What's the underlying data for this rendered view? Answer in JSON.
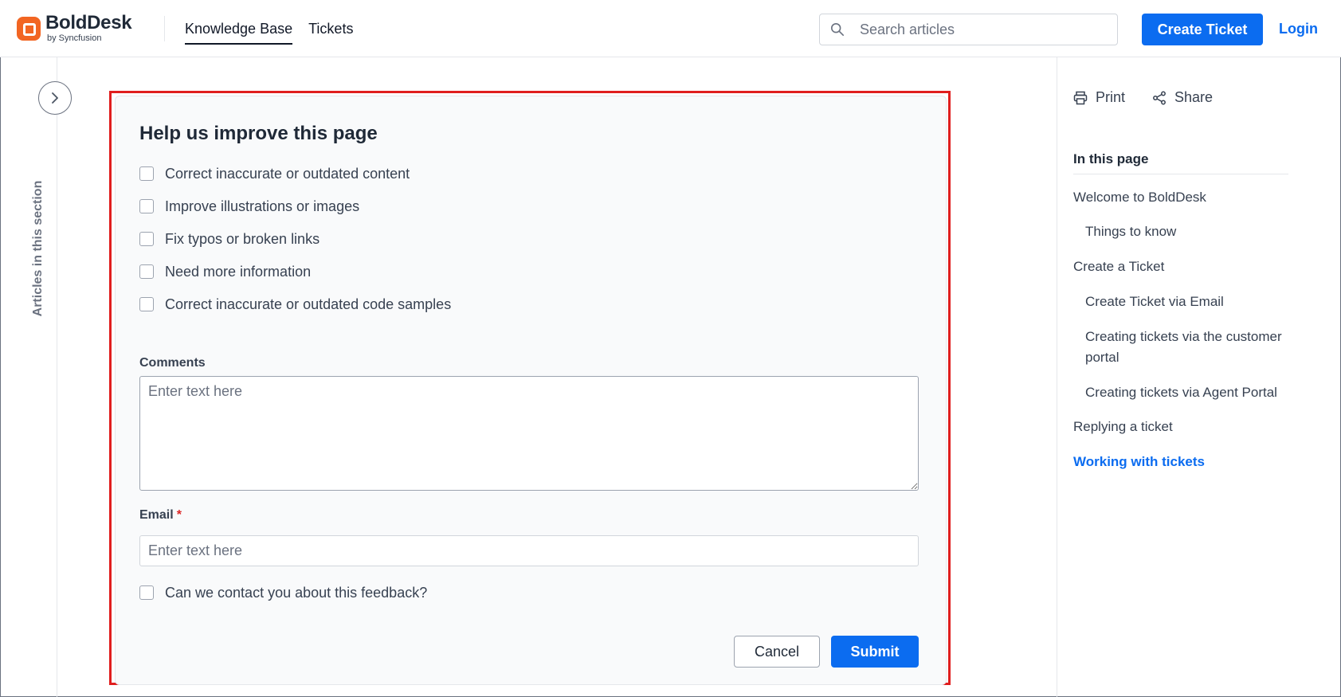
{
  "header": {
    "logo_name": "BoldDesk",
    "logo_sub": "by Syncfusion",
    "nav": [
      "Knowledge Base",
      "Tickets"
    ],
    "search_placeholder": "Search articles",
    "create_ticket": "Create Ticket",
    "login": "Login"
  },
  "left_rail": {
    "label": "Articles in this section"
  },
  "feedback": {
    "title": "Help us improve this page",
    "options": [
      "Correct inaccurate or outdated content",
      "Improve illustrations or images",
      "Fix typos or broken links",
      "Need more information",
      "Correct inaccurate or outdated code samples"
    ],
    "comments_label": "Comments",
    "comments_placeholder": "Enter text here",
    "email_label": "Email",
    "email_required": "*",
    "email_placeholder": "Enter text here",
    "contact_label": "Can we contact you about this feedback?",
    "cancel": "Cancel",
    "submit": "Submit"
  },
  "right_rail": {
    "print": "Print",
    "share": "Share",
    "toc_title": "In this page",
    "toc": [
      "Welcome to BoldDesk",
      "Things to know",
      "Create a Ticket",
      "Create Ticket via Email",
      "Creating tickets via the customer portal",
      "Creating tickets via Agent Portal",
      "Replying a ticket",
      "Working with tickets"
    ]
  },
  "colors": {
    "accent": "#0b6cf0",
    "brand": "#f26522",
    "highlight": "#e01e1e"
  }
}
